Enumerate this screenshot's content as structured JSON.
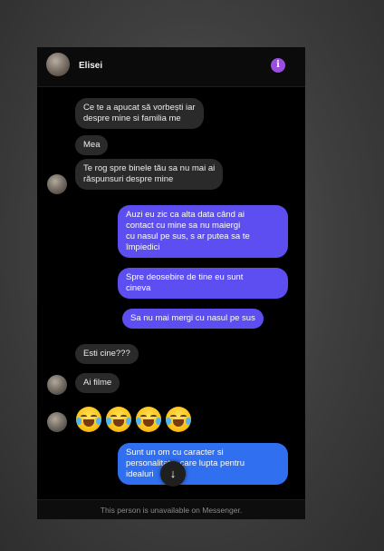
{
  "header": {
    "contact_name": "Elisei",
    "info_glyph": "i",
    "info_color": "#9b4de0"
  },
  "messages": [
    {
      "side": "in",
      "text": "Ce te a apucat să vorbești  iar\ndespre mine si familia me"
    },
    {
      "side": "in",
      "text": "Mea"
    },
    {
      "side": "in",
      "text": "Te rog spre binele tău sa nu mai ai\nrăspunsuri despre mine"
    },
    {
      "side": "out",
      "text": "Auzi eu zic ca alta data când ai\ncontact cu mine sa nu maiergi\ncu nasul pe sus, s ar putea sa te\nîmpiedici"
    },
    {
      "side": "out",
      "text": "Spre deosebire de tine eu sunt\ncineva"
    },
    {
      "side": "out",
      "text": "Sa nu mai mergi cu nasul pe sus"
    },
    {
      "side": "in",
      "text": "Esti cine???"
    },
    {
      "side": "in",
      "text": "Ai filme"
    },
    {
      "side": "in",
      "emoji": "rolling-on-floor-laughing",
      "count": 4
    },
    {
      "side": "out",
      "text": "Sunt un om cu caracter si\npersonalitate, care lupta pentru\nidealuri"
    }
  ],
  "scroll_down_glyph": "↓",
  "footer": {
    "text": "This person is unavailable on Messenger."
  },
  "colors": {
    "outgoing": "#5c4ef0",
    "outgoing_latest": "#2f6ff0",
    "incoming": "#2a2a2a"
  }
}
